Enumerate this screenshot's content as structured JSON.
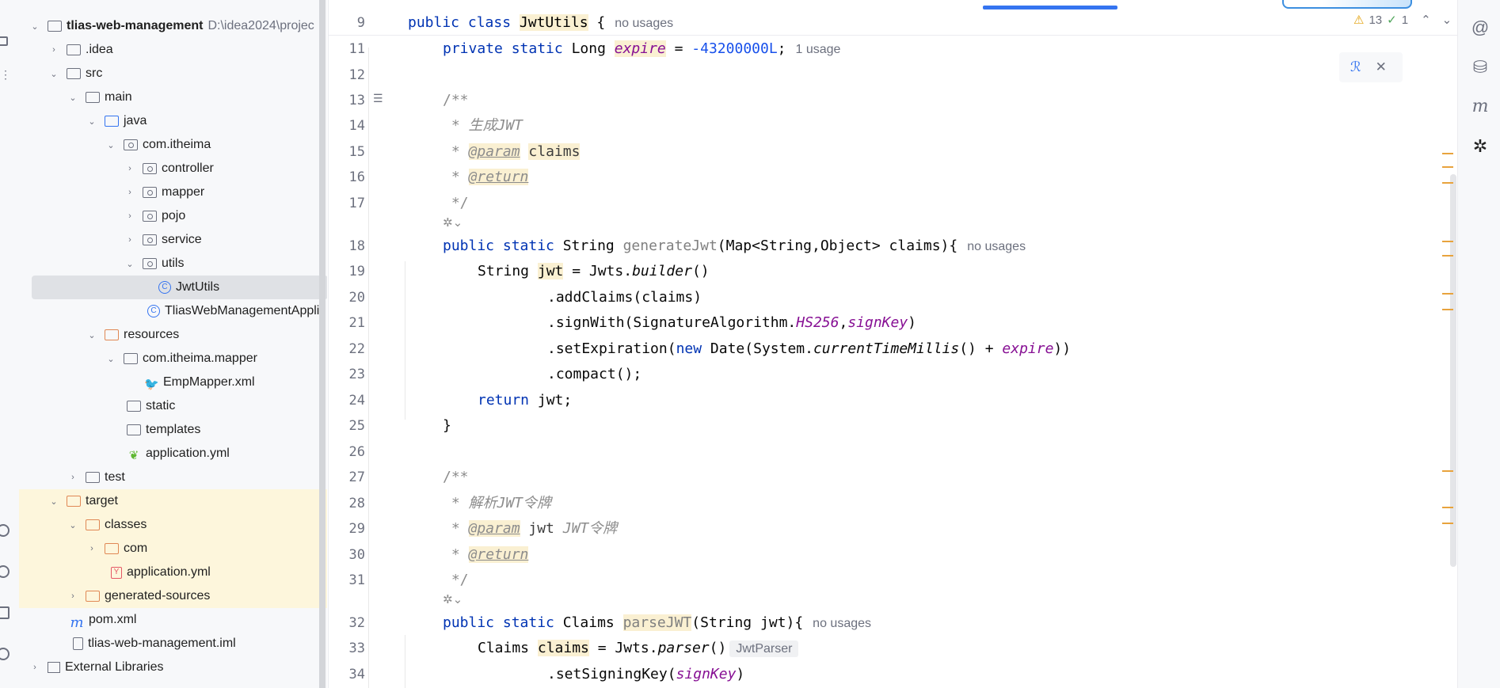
{
  "project": {
    "root_name": "tlias-web-management",
    "root_path": "D:\\idea2024\\projec",
    "items": [
      {
        "label": ".idea"
      },
      {
        "label": "src"
      },
      {
        "label": "main"
      },
      {
        "label": "java"
      },
      {
        "label": "com.itheima"
      },
      {
        "label": "controller"
      },
      {
        "label": "mapper"
      },
      {
        "label": "pojo"
      },
      {
        "label": "service"
      },
      {
        "label": "utils"
      },
      {
        "label": "JwtUtils"
      },
      {
        "label": "TliasWebManagementApplic"
      },
      {
        "label": "resources"
      },
      {
        "label": "com.itheima.mapper"
      },
      {
        "label": "EmpMapper.xml"
      },
      {
        "label": "static"
      },
      {
        "label": "templates"
      },
      {
        "label": "application.yml"
      },
      {
        "label": "test"
      },
      {
        "label": "target"
      },
      {
        "label": "classes"
      },
      {
        "label": "com"
      },
      {
        "label": "application.yml"
      },
      {
        "label": "generated-sources"
      },
      {
        "label": "pom.xml"
      },
      {
        "label": "tlias-web-management.iml"
      },
      {
        "label": "External Libraries"
      }
    ]
  },
  "editor": {
    "status": {
      "warnings": "13",
      "checks": "1"
    },
    "sticky_line": "9",
    "lines": [
      "11",
      "12",
      "13",
      "14",
      "15",
      "16",
      "17",
      "18",
      "19",
      "20",
      "21",
      "22",
      "23",
      "24",
      "25",
      "26",
      "27",
      "28",
      "29",
      "30",
      "31",
      "32",
      "33",
      "34"
    ],
    "code": {
      "l9_a": "public class ",
      "l9_b": "JwtUtils",
      "l9_c": " {",
      "l11_a": "private static ",
      "l11_b": "Long ",
      "l11_c": "expire",
      "l11_d": " = ",
      "l11_e": "-43200000L",
      "l11_f": ";",
      "l13": "/**",
      "l14": " * 生成JWT",
      "l15_a": " * ",
      "l15_b": "@param",
      "l15_c": " ",
      "l15_d": "claims",
      "l16_a": " * ",
      "l16_b": "@return",
      "l17": " */",
      "l18_a": "public static ",
      "l18_b": "String ",
      "l18_c": "generateJwt",
      "l18_d": "(Map<String,Object> claims){",
      "l19_a": "String ",
      "l19_b": "jwt",
      "l19_c": " = Jwts.",
      "l19_d": "builder",
      "l19_e": "()",
      "l20": ".addClaims(claims)",
      "l21_a": ".signWith(SignatureAlgorithm.",
      "l21_b": "HS256",
      "l21_c": ",",
      "l21_d": "signKey",
      "l21_e": ")",
      "l22_a": ".setExpiration(",
      "l22_b": "new ",
      "l22_c": "Date(System.",
      "l22_d": "currentTimeMillis",
      "l22_e": "() + ",
      "l22_f": "expire",
      "l22_g": "))",
      "l23": ".compact();",
      "l24_a": "return ",
      "l24_b": "jwt;",
      "l25": "}",
      "l27": "/**",
      "l28": " * 解析JWT令牌",
      "l29_a": " * ",
      "l29_b": "@param",
      "l29_c": " jwt ",
      "l29_d": "JWT令牌",
      "l30_a": " * ",
      "l30_b": "@return",
      "l31": " */",
      "l32_a": "public static ",
      "l32_b": "Claims ",
      "l32_c": "parseJWT",
      "l32_d": "(String jwt){",
      "l33_a": "Claims ",
      "l33_b": "claims",
      "l33_c": " = Jwts.",
      "l33_d": "parser",
      "l33_e": "()",
      "l34_a": ".setSigningKey(",
      "l34_b": "signKey",
      "l34_c": ")"
    },
    "hints": {
      "no_usages": "no usages",
      "one_usage": "1 usage",
      "inlay_type": "JwtParser"
    }
  },
  "colors": {
    "accent": "#3574f0",
    "keyword": "#0033b3",
    "field": "#871094",
    "comment": "#8c8c8c",
    "highlight": "#faf0d2",
    "warning": "#e3a008"
  }
}
